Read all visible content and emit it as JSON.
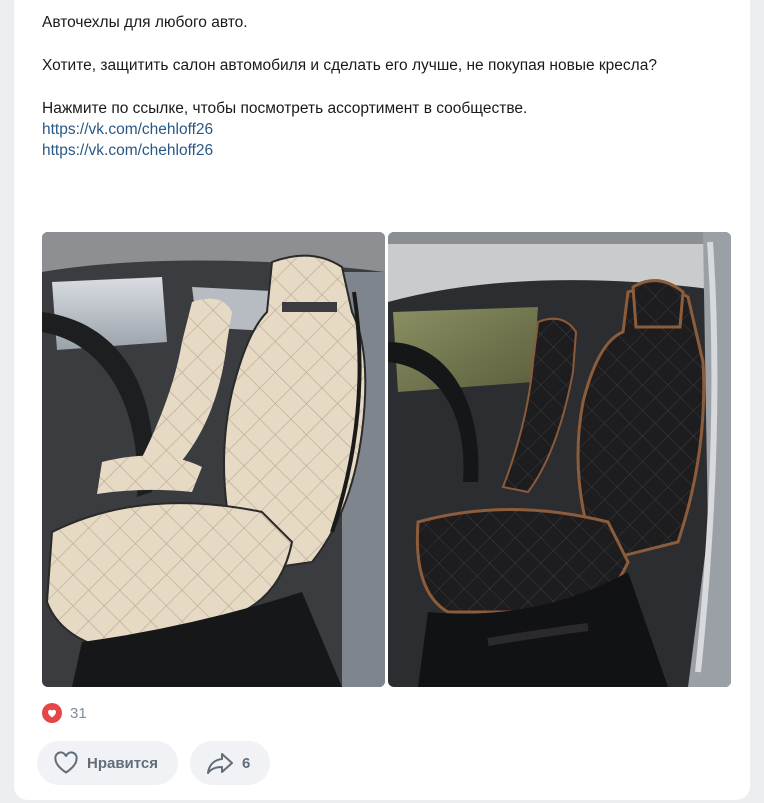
{
  "post": {
    "line1": "Авточехлы для любого авто.",
    "line2": "Хотите, защитить салон автомобиля и сделать его лучше, не покупая новые кресла?",
    "line3": "Нажмите по ссылке, чтобы посмотреть ассортимент в сообществе.",
    "links": [
      "https://vk.com/chehloff26",
      "https://vk.com/chehloff26"
    ]
  },
  "photos": [
    {
      "name": "beige-seat-covers-photo",
      "cover_color": "#e6d9c3"
    },
    {
      "name": "black-seat-covers-photo",
      "cover_color": "#1c1c1e"
    }
  ],
  "reactions": {
    "icon": "heart-icon",
    "count": "31",
    "color": "#e64646"
  },
  "actions": {
    "like_label": "Нравится",
    "share_count": "6"
  }
}
